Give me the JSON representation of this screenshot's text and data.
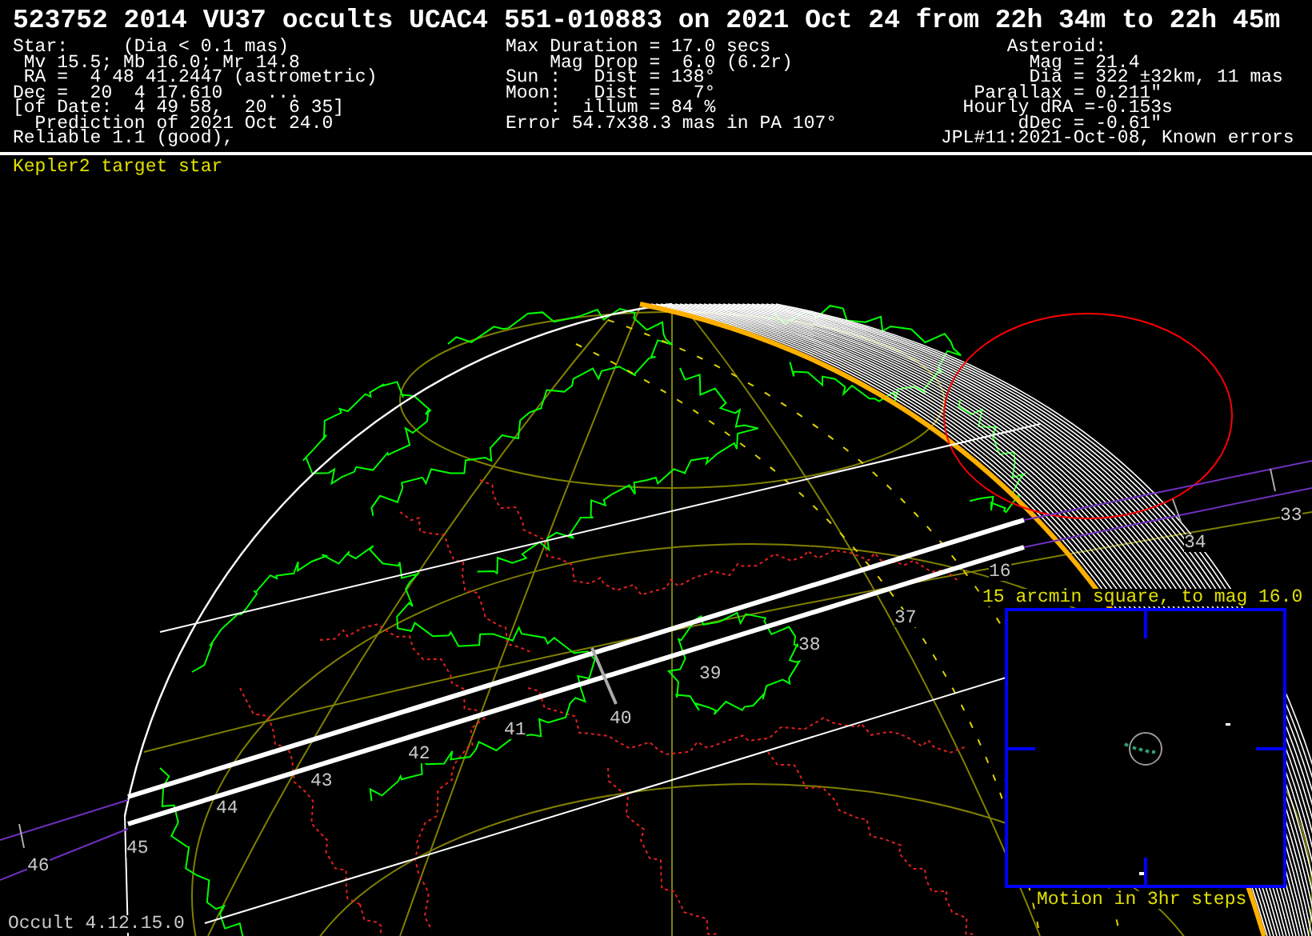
{
  "title": "523752 2014 VU37 occults UCAC4 551-010883 on 2021 Oct 24 from 22h 34m to 22h 45m",
  "header_columns": [
    {
      "lines": [
        "Star:     (Dia < 0.1 mas)",
        " Mv 15.5; Mb 16.0; Mr 14.8",
        " RA =  4 48 41.2447 (astrometric)",
        "Dec =  20  4 17.610    ...",
        "[of Date:  4 49 58,  20  6 35]",
        "  Prediction of 2021 Oct 24.0",
        "Reliable 1.1 (good),"
      ]
    },
    {
      "lines": [
        "Max Duration = 17.0 secs",
        "    Mag Drop =  6.0 (6.2r)",
        "Sun :   Dist = 138°",
        "Moon:   Dist =   7°",
        "    :  illum = 84 %",
        "Error 54.7x38.3 mas in PA 107°"
      ]
    },
    {
      "lines": [
        "      Asteroid:",
        "        Mag = 21.4",
        "        Dia = 322 ±32km, 11 mas",
        "   Parallax = 0.211\"",
        "  Hourly dRA =-0.153s",
        "       dDec = -0.61\"",
        "JPL#11:2021-Oct-08, Known errors"
      ]
    }
  ],
  "note": "Kepler2 target star",
  "time_labels": [
    "33",
    "34",
    "16",
    "37",
    "38",
    "39",
    "40",
    "41",
    "42",
    "43",
    "44",
    "45",
    "46"
  ],
  "inset": {
    "caption": "15 arcmin square, to mag 16.0",
    "motion_note": "Motion in 3hr steps"
  },
  "footer": "Occult 4.12.15.0"
}
